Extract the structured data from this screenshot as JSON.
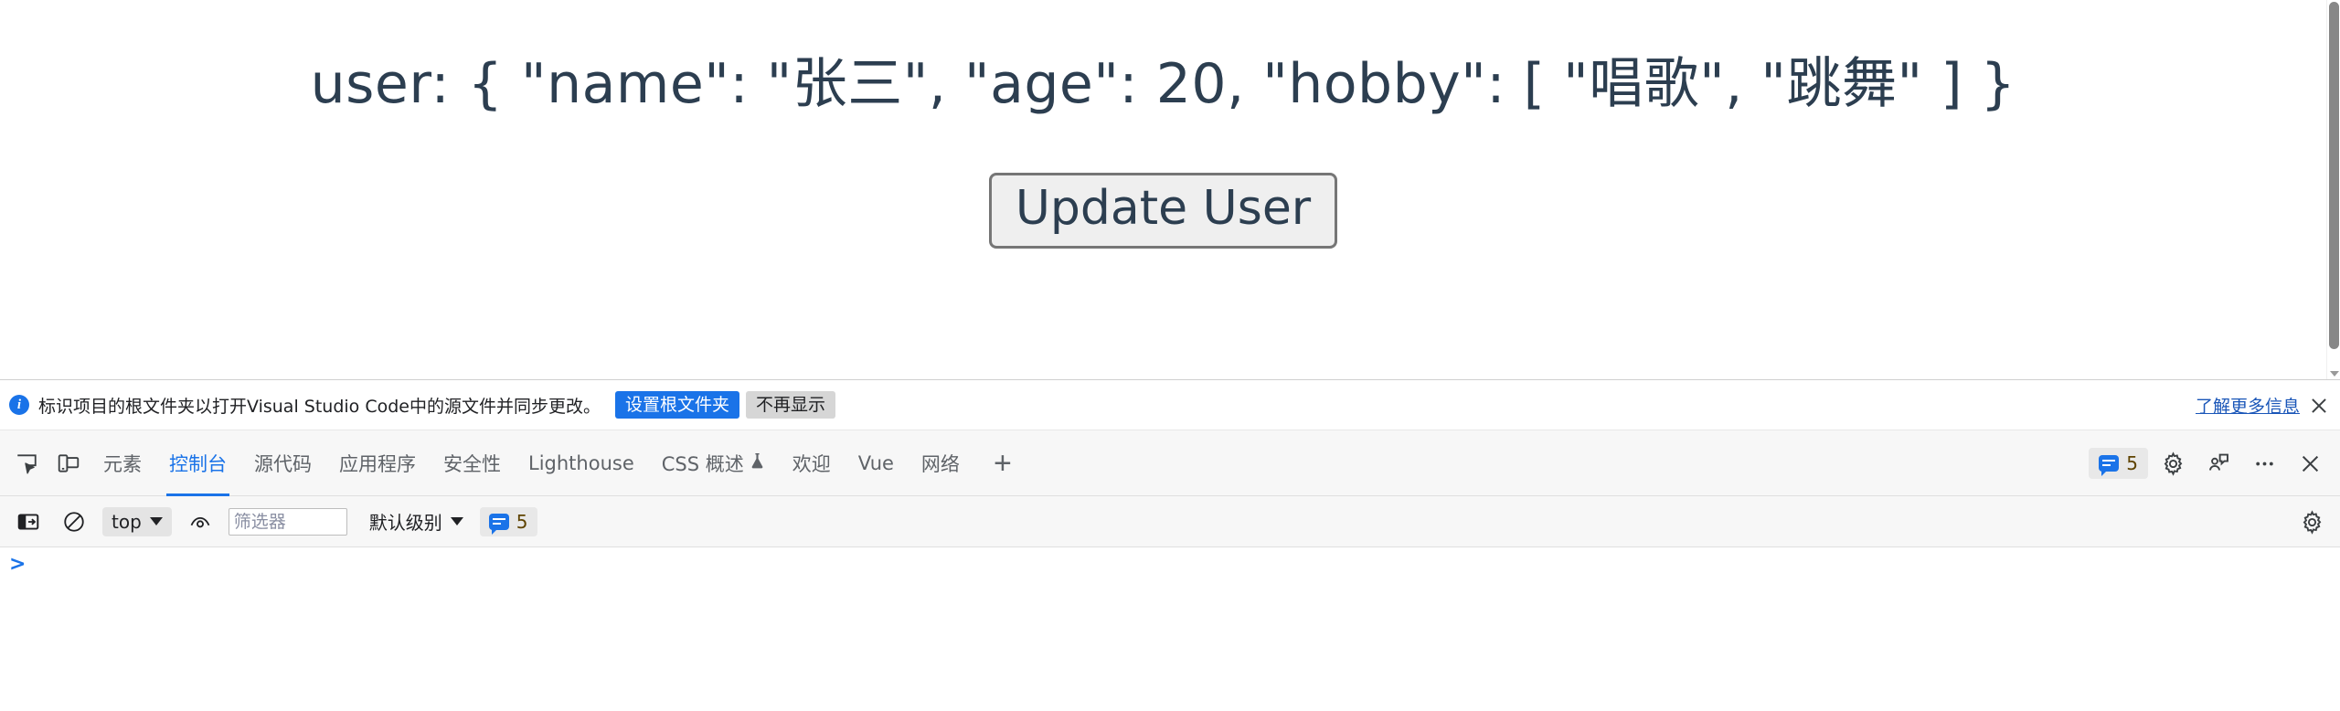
{
  "page": {
    "user_line": "user: { \"name\": \"张三\", \"age\": 20, \"hobby\": [ \"唱歌\", \"跳舞\" ] }",
    "update_button_label": "Update User",
    "text_color": "#2c3e50",
    "button_bg": "#efefef",
    "button_border": "#767676"
  },
  "notification": {
    "icon": "info-icon",
    "message": "标识项目的根文件夹以打开Visual Studio Code中的源文件并同步更改。",
    "primary_button": "设置根文件夹",
    "secondary_button": "不再显示",
    "learn_more": "了解更多信息",
    "close_icon": "close-icon",
    "primary_color": "#1a73e8",
    "link_color": "#1a56b8"
  },
  "devtools": {
    "left_icons": [
      {
        "name": "inspect-element-icon"
      },
      {
        "name": "device-toolbar-icon"
      }
    ],
    "tabs": [
      {
        "label": "元素",
        "active": false,
        "experimental": false
      },
      {
        "label": "控制台",
        "active": true,
        "experimental": false
      },
      {
        "label": "源代码",
        "active": false,
        "experimental": false
      },
      {
        "label": "应用程序",
        "active": false,
        "experimental": false
      },
      {
        "label": "安全性",
        "active": false,
        "experimental": false
      },
      {
        "label": "Lighthouse",
        "active": false,
        "experimental": false
      },
      {
        "label": "CSS 概述",
        "active": false,
        "experimental": true
      },
      {
        "label": "欢迎",
        "active": false,
        "experimental": false
      },
      {
        "label": "Vue",
        "active": false,
        "experimental": false
      },
      {
        "label": "网络",
        "active": false,
        "experimental": false
      }
    ],
    "add_tab_label": "+",
    "right_icons": [
      {
        "name": "settings-gear-icon"
      },
      {
        "name": "feedback-icon"
      },
      {
        "name": "more-options-icon"
      },
      {
        "name": "close-devtools-icon"
      }
    ],
    "message_count": "5",
    "active_tab_color": "#1a73e8",
    "tab_color": "#5f6368"
  },
  "console": {
    "sidebar_toggle_icon": "console-sidebar-icon",
    "clear_console_icon": "clear-console-icon",
    "context": "top",
    "live_expression_icon": "eye-icon",
    "filter_placeholder": "筛选器",
    "filter_value": "",
    "level": "默认级别",
    "message_count": "5",
    "settings_icon": "console-settings-icon",
    "prompt_symbol": ">",
    "prompt_value": ""
  }
}
